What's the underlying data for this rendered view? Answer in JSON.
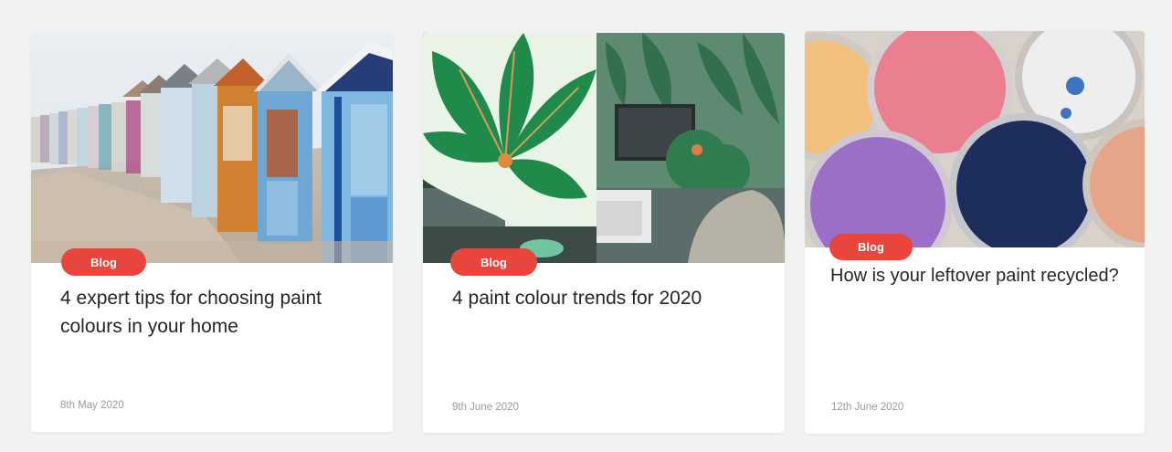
{
  "colors": {
    "page_bg": "#f1f2f2",
    "card_bg": "#ffffff",
    "badge_bg": "#e9453d",
    "badge_text": "#ffffff",
    "title_text": "#262626",
    "date_text": "#9a9a9a"
  },
  "cards": [
    {
      "badge": "Blog",
      "title": "4 expert tips for choosing paint colours in your home",
      "date": "8th May 2020",
      "image": "beach-huts-image"
    },
    {
      "badge": "Blog",
      "title": "4 paint colour trends for 2020",
      "date": "9th June 2020",
      "image": "tropical-living-room-image"
    },
    {
      "badge": "Blog",
      "title": "How is your leftover paint recycled?",
      "date": "12th June 2020",
      "image": "paint-tins-image"
    }
  ]
}
